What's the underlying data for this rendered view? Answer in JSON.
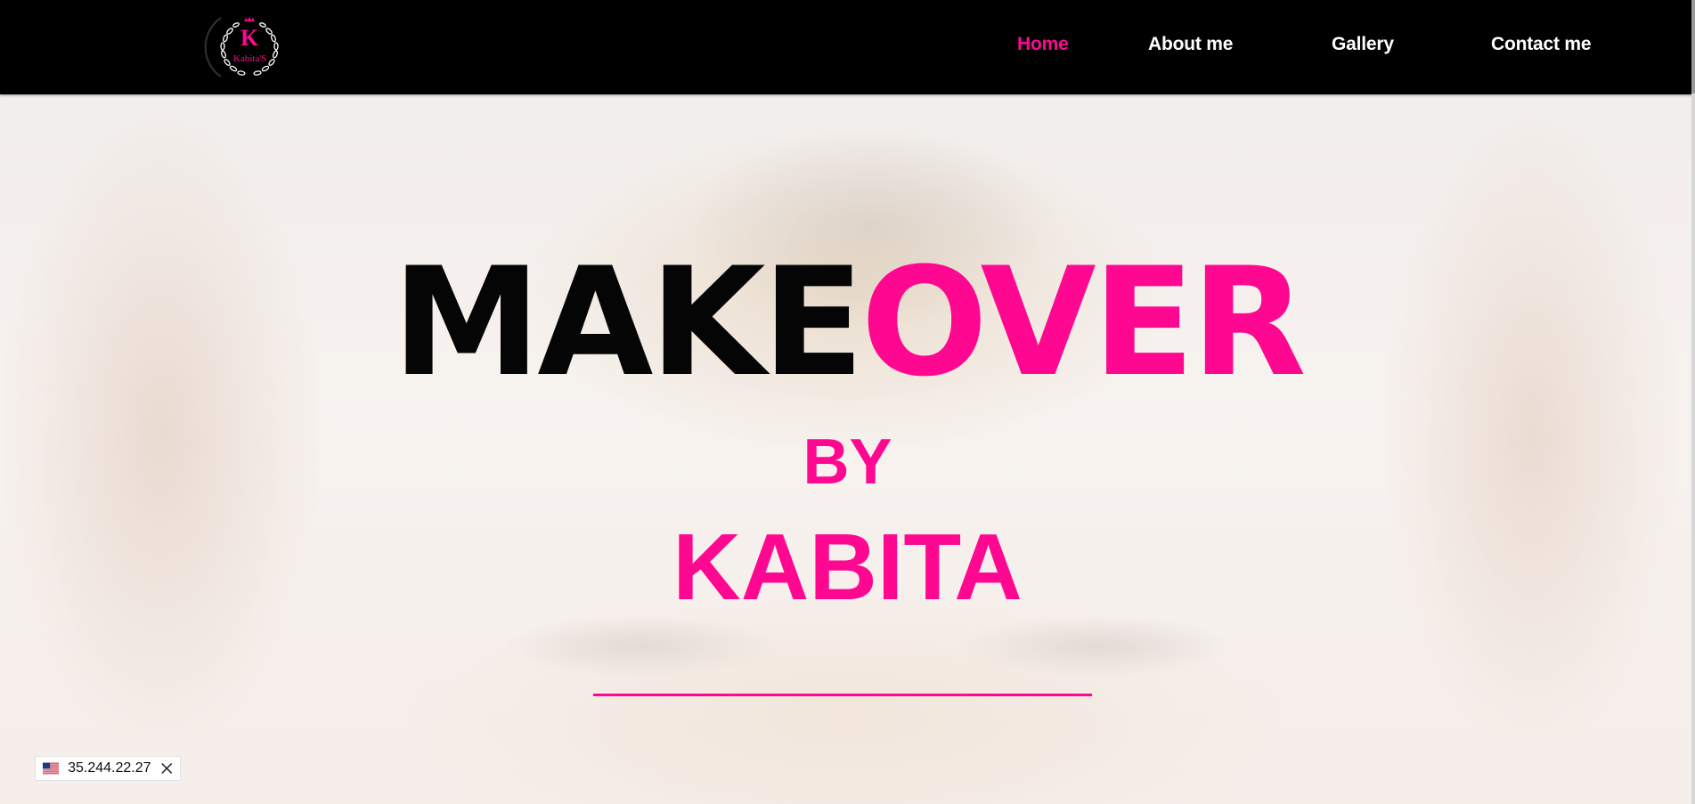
{
  "header": {
    "logo": {
      "icon": "kabitas-logo-wreath-icon",
      "letter": "K",
      "name": "Kabita'S"
    },
    "nav": [
      {
        "label": "Home",
        "active": true
      },
      {
        "label": "About me",
        "active": false
      },
      {
        "label": "Gallery",
        "active": false
      },
      {
        "label": "Contact me",
        "active": false
      }
    ]
  },
  "hero": {
    "title_part1": "MAKE",
    "title_part2": "OVER",
    "by": "BY",
    "name": "KABITA"
  },
  "ip_badge": {
    "flag_icon": "us-flag-icon",
    "ip": "35.244.22.27",
    "close_icon": "close-icon"
  },
  "colors": {
    "accent": "#ff0891",
    "header_bg": "#000000",
    "title_dark": "#050505"
  }
}
